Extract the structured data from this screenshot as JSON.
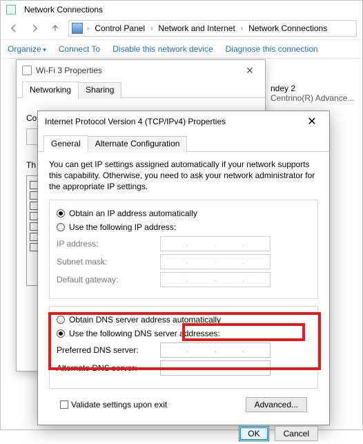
{
  "explorer": {
    "window_title": "Network Connections",
    "breadcrumb": [
      "Control Panel",
      "Network and Internet",
      "Network Connections"
    ],
    "toolbar": {
      "organize": "Organize",
      "connect_to": "Connect To",
      "disable": "Disable this network device",
      "diagnose": "Diagnose this connection"
    },
    "visible_item": {
      "name_fragment": "ndey 2",
      "adapter_fragment": "Centrino(R) Advance..."
    }
  },
  "wifi_dialog": {
    "title": "Wi-Fi 3 Properties",
    "tabs": {
      "networking": "Networking",
      "sharing": "Sharing"
    },
    "connect_using_label_fragment": "Co",
    "items_label_fragment": "Th"
  },
  "ipv4_dialog": {
    "title": "Internet Protocol Version 4 (TCP/IPv4) Properties",
    "tabs": {
      "general": "General",
      "alt": "Alternate Configuration"
    },
    "description": "You can get IP settings assigned automatically if your network supports this capability. Otherwise, you need to ask your network administrator for the appropriate IP settings.",
    "ip_group": {
      "auto": "Obtain an IP address automatically",
      "manual": "Use the following IP address:",
      "ip_label": "IP address:",
      "mask_label": "Subnet mask:",
      "gw_label": "Default gateway:",
      "selected": "auto"
    },
    "dns_group": {
      "auto": "Obtain DNS server address automatically",
      "manual": "Use the following DNS server addresses:",
      "pref_label": "Preferred DNS server:",
      "alt_label": "Alternate DNS server:",
      "selected": "manual"
    },
    "validate_label": "Validate settings upon exit",
    "advanced_label": "Advanced...",
    "ok_label": "OK",
    "cancel_label": "Cancel"
  }
}
